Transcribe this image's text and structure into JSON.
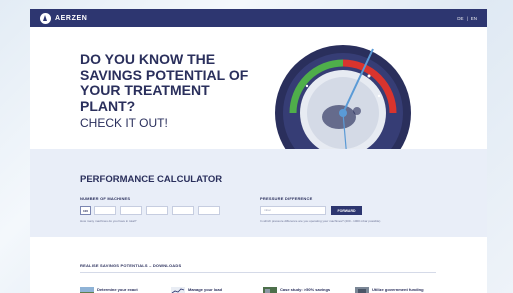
{
  "header": {
    "brand": "AERZEN",
    "languages": [
      "DE",
      "|",
      "EN"
    ]
  },
  "hero": {
    "title": "DO YOU KNOW THE SAVINGS POTENTIAL OF YOUR TREATMENT PLANT?",
    "cta": "CHECK IT OUT!"
  },
  "calculator": {
    "title": "PERFORMANCE CALCULATOR",
    "machines_label": "NUMBER OF MACHINES",
    "machines_first_value": "100",
    "machines_hint": "How many machines do you have in total?",
    "pressure_label": "PRESSURE DIFFERENCE",
    "pressure_placeholder": "mbar",
    "forward_label": "FORWARD",
    "pressure_hint": "In which pressure difference are you operating your machines? (200 - 1000 mbar possible)"
  },
  "downloads": {
    "heading": "REALISE SAVINGS POTENTIALS – DOWNLOADS",
    "items": [
      {
        "label": "Determine your exact"
      },
      {
        "label": "Manage your load"
      },
      {
        "label": "Case study: >50% savings"
      },
      {
        "label": "Utilize government funding"
      }
    ]
  }
}
